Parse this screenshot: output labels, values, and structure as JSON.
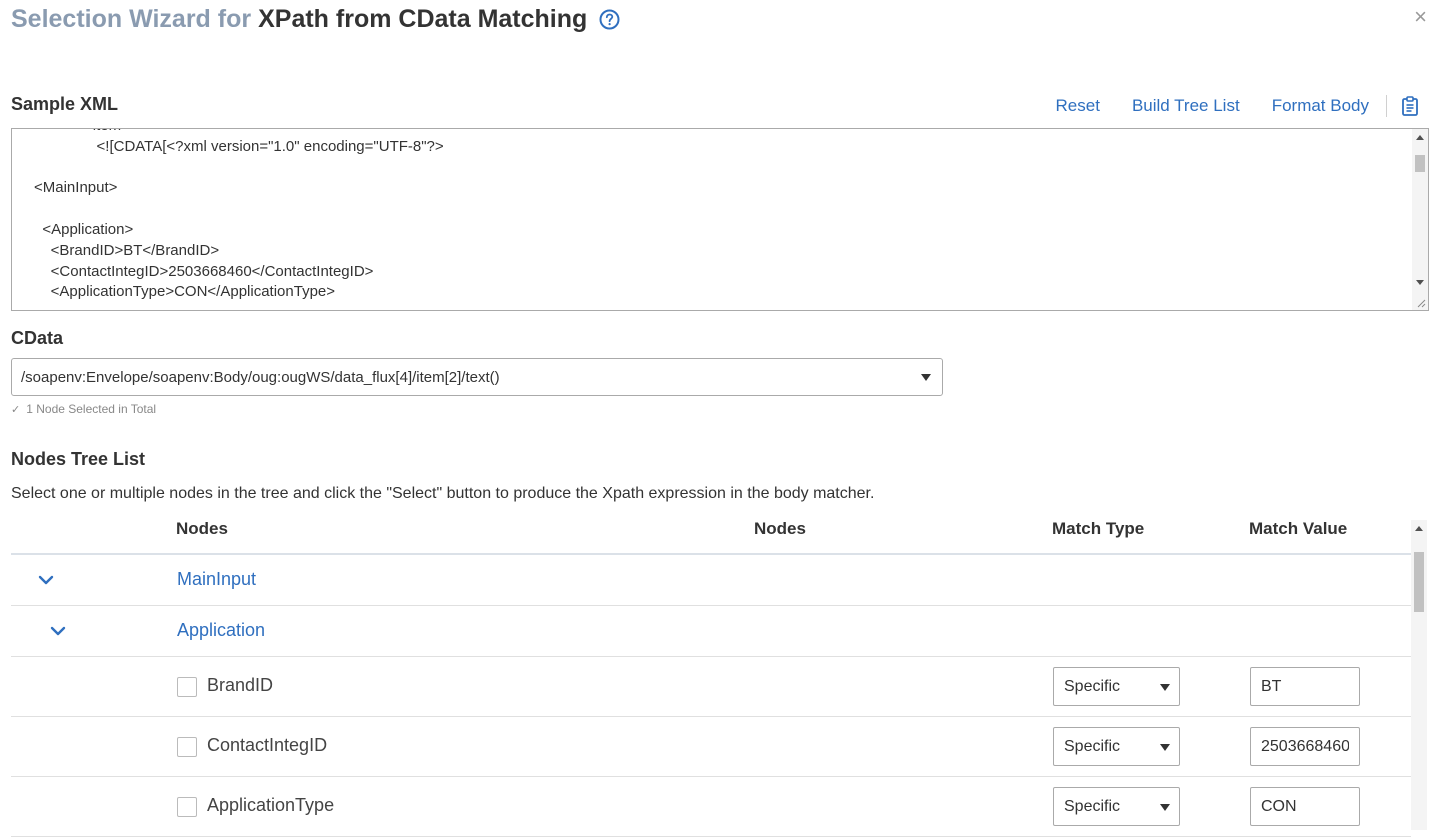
{
  "dialog": {
    "title_prefix": "Selection Wizard for",
    "title_main": "XPath from CData Matching",
    "help_icon": "question-circle-icon",
    "close_icon": "close-x-icon",
    "close_glyph": "×"
  },
  "sample_xml": {
    "label": "Sample XML",
    "toolbar": {
      "reset": "Reset",
      "build_tree_list": "Build Tree List",
      "format_body": "Format Body",
      "clipboard_icon": "clipboard-icon"
    },
    "content": "            <item>\n               <![CDATA[<?xml version=\"1.0\" encoding=\"UTF-8\"?>\n\n<MainInput>\n\n  <Application>\n    <BrandID>BT</BrandID>\n    <ContactIntegID>2503668460</ContactIntegID>\n    <ApplicationType>CON</ApplicationType>"
  },
  "cdata": {
    "label": "CData",
    "selected_value": "/soapenv:Envelope/soapenv:Body/oug:ougWS/data_flux[4]/item[2]/text()",
    "selected_info": "1 Node Selected in Total",
    "check_icon": "check-icon",
    "check_glyph": "✓"
  },
  "nodes_tree": {
    "label": "Nodes Tree List",
    "description": "Select one or multiple nodes in the tree and click the \"Select\" button to produce the Xpath expression in the body matcher.",
    "headers": {
      "nodes_1": "Nodes",
      "nodes_2": "Nodes",
      "match_type": "Match Type",
      "match_value": "Match Value"
    },
    "parents": [
      {
        "label": "MainInput"
      },
      {
        "label": "Application"
      }
    ],
    "rows": [
      {
        "label": "BrandID",
        "match_type": "Specific",
        "match_value": "BT"
      },
      {
        "label": "ContactIntegID",
        "match_type": "Specific",
        "match_value": "2503668460"
      },
      {
        "label": "ApplicationType",
        "match_type": "Specific",
        "match_value": "CON"
      }
    ]
  },
  "colors": {
    "link": "#2f6fbf",
    "title_prefix": "#8a9bb0",
    "text": "#333333"
  }
}
